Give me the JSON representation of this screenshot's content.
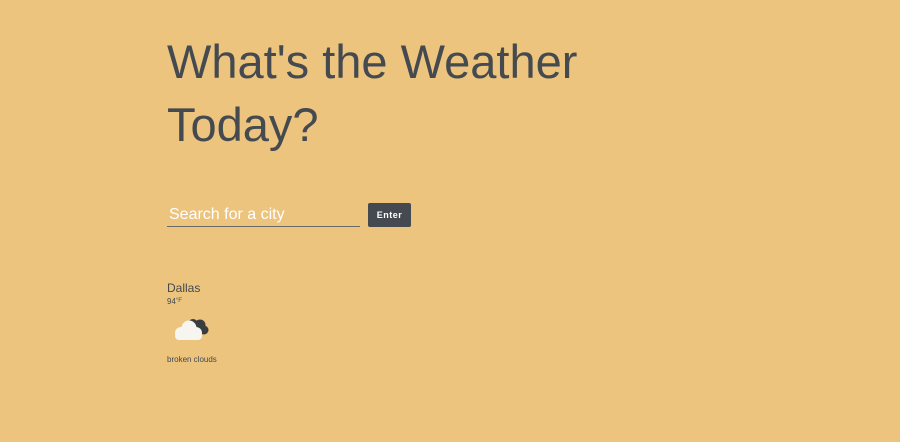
{
  "app": {
    "title": "What's the Weather Today?"
  },
  "search": {
    "placeholder": "Search for a city",
    "value": "",
    "button_label": "Enter"
  },
  "result": {
    "city": "Dallas",
    "temperature": "94",
    "unit": "°F",
    "description": "broken clouds",
    "icon": "broken-clouds-icon"
  },
  "colors": {
    "background": "#ECC47E",
    "text": "#444A4F",
    "button": "#444A4F",
    "placeholder": "#FFFFFF"
  }
}
